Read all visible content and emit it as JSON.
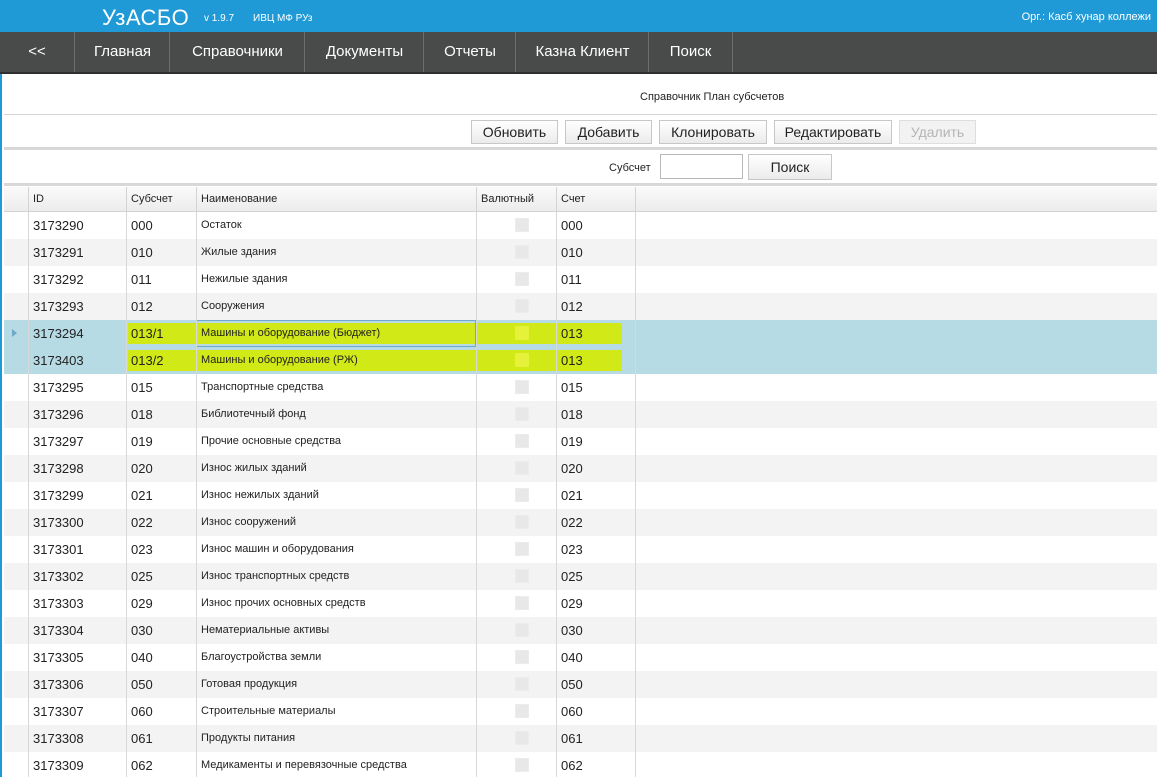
{
  "header": {
    "app_title": "УзАСБО",
    "version": "v 1.9.7",
    "org_short": "ИВЦ МФ РУз",
    "org_label": "Орг.: Касб хунар коллежи"
  },
  "nav": {
    "items": [
      {
        "label": "<<"
      },
      {
        "label": "Главная"
      },
      {
        "label": "Справочники"
      },
      {
        "label": "Документы"
      },
      {
        "label": "Отчеты"
      },
      {
        "label": "Казна Клиент"
      },
      {
        "label": "Поиск"
      }
    ]
  },
  "page": {
    "title": "Справочник План субсчетов"
  },
  "toolbar": {
    "refresh": "Обновить",
    "add": "Добавить",
    "clone": "Клонировать",
    "edit": "Редактировать",
    "delete": "Удалить"
  },
  "search": {
    "label": "Субсчет",
    "value": "",
    "button": "Поиск"
  },
  "table": {
    "columns": [
      "ID",
      "Субсчет",
      "Наименование",
      "Валютный",
      "Счет"
    ],
    "rows": [
      {
        "id": "3173290",
        "sub": "000",
        "name": "Остаток",
        "currency": false,
        "account": "000"
      },
      {
        "id": "3173291",
        "sub": "010",
        "name": "Жилые здания",
        "currency": false,
        "account": "010"
      },
      {
        "id": "3173292",
        "sub": "011",
        "name": "Нежилые здания",
        "currency": false,
        "account": "011"
      },
      {
        "id": "3173293",
        "sub": "012",
        "name": "Сооружения",
        "currency": false,
        "account": "012"
      },
      {
        "id": "3173294",
        "sub": "013/1",
        "name": "Машины и оборудование (Бюджет)",
        "currency": false,
        "account": "013",
        "selected": true,
        "highlighted": true
      },
      {
        "id": "3173403",
        "sub": "013/2",
        "name": "Машины и оборудование (РЖ)",
        "currency": false,
        "account": "013",
        "selected": true,
        "highlighted": true
      },
      {
        "id": "3173295",
        "sub": "015",
        "name": "Транспортные средства",
        "currency": false,
        "account": "015"
      },
      {
        "id": "3173296",
        "sub": "018",
        "name": "Библиотечный фонд",
        "currency": false,
        "account": "018"
      },
      {
        "id": "3173297",
        "sub": "019",
        "name": "Прочие основные средства",
        "currency": false,
        "account": "019"
      },
      {
        "id": "3173298",
        "sub": "020",
        "name": "Износ жилых зданий",
        "currency": false,
        "account": "020"
      },
      {
        "id": "3173299",
        "sub": "021",
        "name": "Износ нежилых зданий",
        "currency": false,
        "account": "021"
      },
      {
        "id": "3173300",
        "sub": "022",
        "name": "Износ сооружений",
        "currency": false,
        "account": "022"
      },
      {
        "id": "3173301",
        "sub": "023",
        "name": "Износ машин и оборудования",
        "currency": false,
        "account": "023"
      },
      {
        "id": "3173302",
        "sub": "025",
        "name": "Износ транспортных средств",
        "currency": false,
        "account": "025"
      },
      {
        "id": "3173303",
        "sub": "029",
        "name": "Износ прочих основных средств",
        "currency": false,
        "account": "029"
      },
      {
        "id": "3173304",
        "sub": "030",
        "name": "Нематериальные активы",
        "currency": false,
        "account": "030"
      },
      {
        "id": "3173305",
        "sub": "040",
        "name": "Благоустройства земли",
        "currency": false,
        "account": "040"
      },
      {
        "id": "3173306",
        "sub": "050",
        "name": "Готовая продукция",
        "currency": false,
        "account": "050"
      },
      {
        "id": "3173307",
        "sub": "060",
        "name": "Строительные материалы",
        "currency": false,
        "account": "060"
      },
      {
        "id": "3173308",
        "sub": "061",
        "name": "Продукты питания",
        "currency": false,
        "account": "061"
      },
      {
        "id": "3173309",
        "sub": "062",
        "name": "Медикаменты и перевязочные средства",
        "currency": false,
        "account": "062"
      }
    ]
  },
  "colors": {
    "topbar": "#1f9ad6",
    "navbar": "#494a4a",
    "selected_row": "#b7dbe5",
    "highlight": "#d4ea00"
  }
}
